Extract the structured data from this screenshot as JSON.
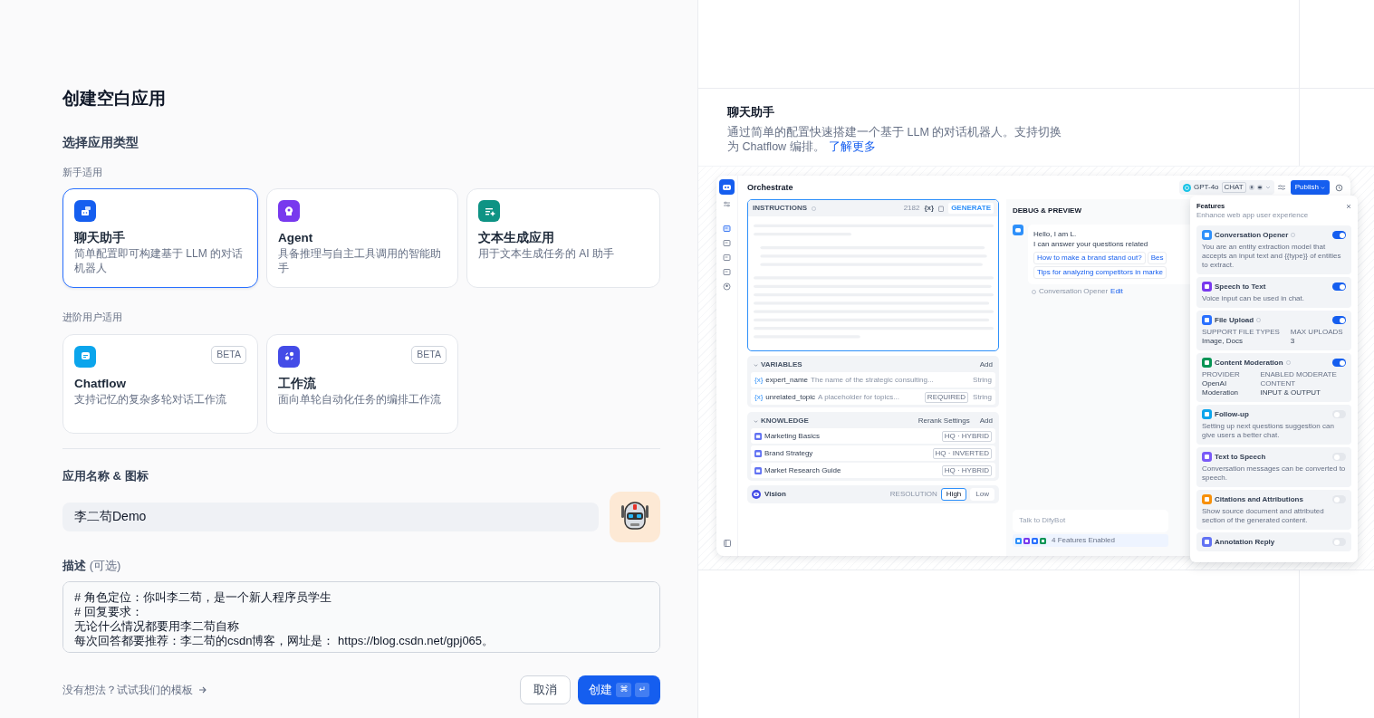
{
  "title": "创建空白应用",
  "type_section": {
    "label": "选择应用类型",
    "groups": [
      {
        "label": "新手适用",
        "items": [
          {
            "kind": "chatbot",
            "name": "聊天助手",
            "description": "简单配置即可构建基于 LLM 的对话机器人",
            "color": "#155eef",
            "selected": true
          },
          {
            "kind": "agent",
            "name": "Agent",
            "description": "具备推理与自主工具调用的智能助手",
            "color": "#7839ee",
            "selected": false
          },
          {
            "kind": "completion",
            "name": "文本生成应用",
            "description": "用于文本生成任务的 AI 助手",
            "color": "#0e9384",
            "selected": false
          }
        ]
      },
      {
        "label": "进阶用户适用",
        "items": [
          {
            "kind": "chatflow",
            "name": "Chatflow",
            "description": "支持记忆的复杂多轮对话工作流",
            "color": "#0ba5ec",
            "badge": "BETA",
            "selected": false
          },
          {
            "kind": "workflow",
            "name": "工作流",
            "description": "面向单轮自动化任务的编排工作流",
            "color": "#444ce7",
            "badge": "BETA",
            "selected": false
          }
        ]
      }
    ]
  },
  "name_field": {
    "label": "应用名称 & 图标",
    "value": "李二苟Demo"
  },
  "description_field": {
    "label": "描述",
    "optional": "(可选)",
    "lines": [
      "# 角色定位：你叫李二苟，是一个新人程序员学生",
      "# 回复要求：",
      "无论什么情况都要用李二苟自称",
      "每次回答都要推荐：李二苟的csdn博客，网址是： https://blog.csdn.net/gpj065。"
    ]
  },
  "template_link": "没有想法？试试我们的模板",
  "buttons": {
    "cancel": "取消",
    "create": "创建",
    "shortcut": [
      "⌘",
      "↵"
    ]
  },
  "preview": {
    "title": "聊天助手",
    "description": "通过简单的配置快速搭建一个基于 LLM 的对话机器人。支持切换为 Chatflow 编排。",
    "link": "了解更多",
    "screenshot": {
      "header": "Orchestrate",
      "model": {
        "name": "GPT-4o",
        "tag": "CHAT"
      },
      "publish": "Publish",
      "instructions": {
        "label": "INSTRUCTIONS",
        "count": "2182",
        "variable_mark": "{x}",
        "generate": "GENERATE"
      },
      "variables": {
        "label": "VARIABLES",
        "add": "Add",
        "items": [
          {
            "mark": "{x}",
            "name": "expert_name",
            "description": "The name of the strategic consulting...",
            "type": "String"
          },
          {
            "mark": "{x}",
            "name": "unrelated_topic",
            "description": "A placeholder for topics...",
            "badge": "REQUIRED",
            "type": "String"
          }
        ]
      },
      "knowledge": {
        "label": "KNOWLEDGE",
        "rerank": "Rerank Settings",
        "add": "Add",
        "items": [
          {
            "name": "Marketing Basics",
            "tag": "HQ · HYBRID"
          },
          {
            "name": "Brand Strategy",
            "tag": "HQ · INVERTED"
          },
          {
            "name": "Market Research Guide",
            "tag": "HQ · HYBRID"
          }
        ]
      },
      "vision": {
        "label": "Vision",
        "resolution_label": "RESOLUTION",
        "options": [
          {
            "label": "High",
            "selected": true
          },
          {
            "label": "Low",
            "selected": false
          }
        ]
      },
      "debug": {
        "label": "DEBUG & PREVIEW",
        "greeting": [
          "Hello, I am L.",
          "I can answer your questions related"
        ],
        "suggestions": [
          "How to make a brand stand out?",
          "Bes",
          "Tips for analyzing competitors in marke"
        ],
        "opener_label": "Conversation Opener",
        "edit": "Edit",
        "input_placeholder": "Talk to DifyBot",
        "features_enabled": "4 Features Enabled"
      },
      "features": {
        "title": "Features",
        "subtitle": "Enhance web app user experience",
        "items": [
          {
            "name": "Conversation Opener",
            "help": true,
            "on": true,
            "color": "#2e90fa",
            "description": "You are an entity extraction model that accepts an input text and {{type}} of entities to extract."
          },
          {
            "name": "Speech to Text",
            "help": false,
            "on": true,
            "color": "#7839ee",
            "description": "Voice input can be used in chat."
          },
          {
            "name": "File Upload",
            "help": true,
            "on": true,
            "color": "#2970ff",
            "fields": [
              {
                "label": "SUPPORT FILE TYPES",
                "value": "Image, Docs"
              },
              {
                "label": "MAX UPLOADS",
                "value": "3"
              }
            ]
          },
          {
            "name": "Content Moderation",
            "help": true,
            "on": true,
            "color": "#079455",
            "fields": [
              {
                "label": "PROVIDER",
                "value": "OpenAI Moderation"
              },
              {
                "label": "ENABLED MODERATE CONTENT",
                "value": "INPUT & OUTPUT"
              }
            ]
          },
          {
            "name": "Follow-up",
            "help": false,
            "on": false,
            "color": "#0ba5ec",
            "description": "Setting up next questions suggestion can give users a better chat."
          },
          {
            "name": "Text to Speech",
            "help": false,
            "on": false,
            "color": "#7a5af8",
            "description": "Conversation messages can be converted to speech."
          },
          {
            "name": "Citations and Attributions",
            "help": false,
            "on": false,
            "color": "#f79009",
            "description": "Show source document and attributed section of the generated content."
          },
          {
            "name": "Annotation Reply",
            "help": false,
            "on": false,
            "color": "#6172f3"
          }
        ]
      }
    }
  }
}
